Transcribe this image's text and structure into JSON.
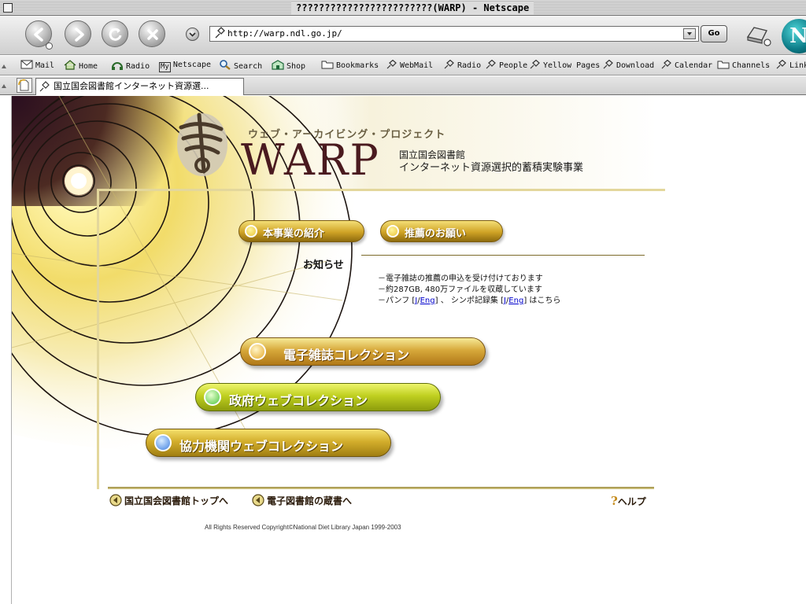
{
  "window": {
    "title": "????????????????????????(WARP) - Netscape"
  },
  "navbar": {
    "url": "http://warp.ndl.go.jp/",
    "go_label": "Go",
    "logo_letter": "N"
  },
  "personal_toolbar": {
    "items": [
      {
        "label": "Mail",
        "icon": "mail-icon"
      },
      {
        "label": "Home",
        "icon": "home-icon"
      },
      {
        "label": "Radio",
        "icon": "radio-icon"
      },
      {
        "label": "Netscape",
        "icon": "my-netscape-icon"
      },
      {
        "label": "Search",
        "icon": "search-icon"
      },
      {
        "label": "Shop",
        "icon": "shop-icon"
      },
      {
        "label": "Bookmarks",
        "icon": "folder-icon"
      },
      {
        "label": "WebMail",
        "icon": "bookmark-icon"
      },
      {
        "label": "Radio",
        "icon": "bookmark-icon"
      },
      {
        "label": "People",
        "icon": "bookmark-icon"
      },
      {
        "label": "Yellow Pages",
        "icon": "bookmark-icon"
      },
      {
        "label": "Download",
        "icon": "bookmark-icon"
      },
      {
        "label": "Calendar",
        "icon": "bookmark-icon"
      },
      {
        "label": "Channels",
        "icon": "folder-icon"
      },
      {
        "label": "Links",
        "icon": "bookmark-icon"
      }
    ],
    "my_badge": "My"
  },
  "tab": {
    "title": "国立国会図書館インターネット資源選..."
  },
  "page": {
    "subtitle": "ウェブ・アーカイビング・プロジェクト",
    "logo": "WARP",
    "org": "国立国会図書館",
    "project": "インターネット資源選択的蓄積実験事業",
    "buttons": {
      "intro": "本事業の紹介",
      "recommend": "推薦のお願い",
      "ejournal": "電子雑誌コレクション",
      "gov": "政府ウェブコレクション",
      "partner": "協力機関ウェブコレクション"
    },
    "notice": {
      "title": "お知らせ",
      "line1": "－電子雑誌の推薦の申込を受け付けております",
      "line2": "－約287GB, 480万ファイルを収蔵しています",
      "line3_prefix": "－パンフ [",
      "line3_j1": "J",
      "line3_sep1": "/",
      "line3_eng1": "Eng",
      "line3_mid": "] 、 シンポ記録集 [",
      "line3_j2": "J",
      "line3_sep2": "/",
      "line3_eng2": "Eng",
      "line3_suffix": "] はこちら"
    },
    "footer": {
      "ndl_top": "国立国会図書館トップへ",
      "ebooks": "電子図書館の蔵書へ",
      "help": "ヘルプ",
      "help_symbol": "?",
      "copyright": "All Rights Reserved Copyright©National Diet Library Japan  1999-2003"
    }
  }
}
